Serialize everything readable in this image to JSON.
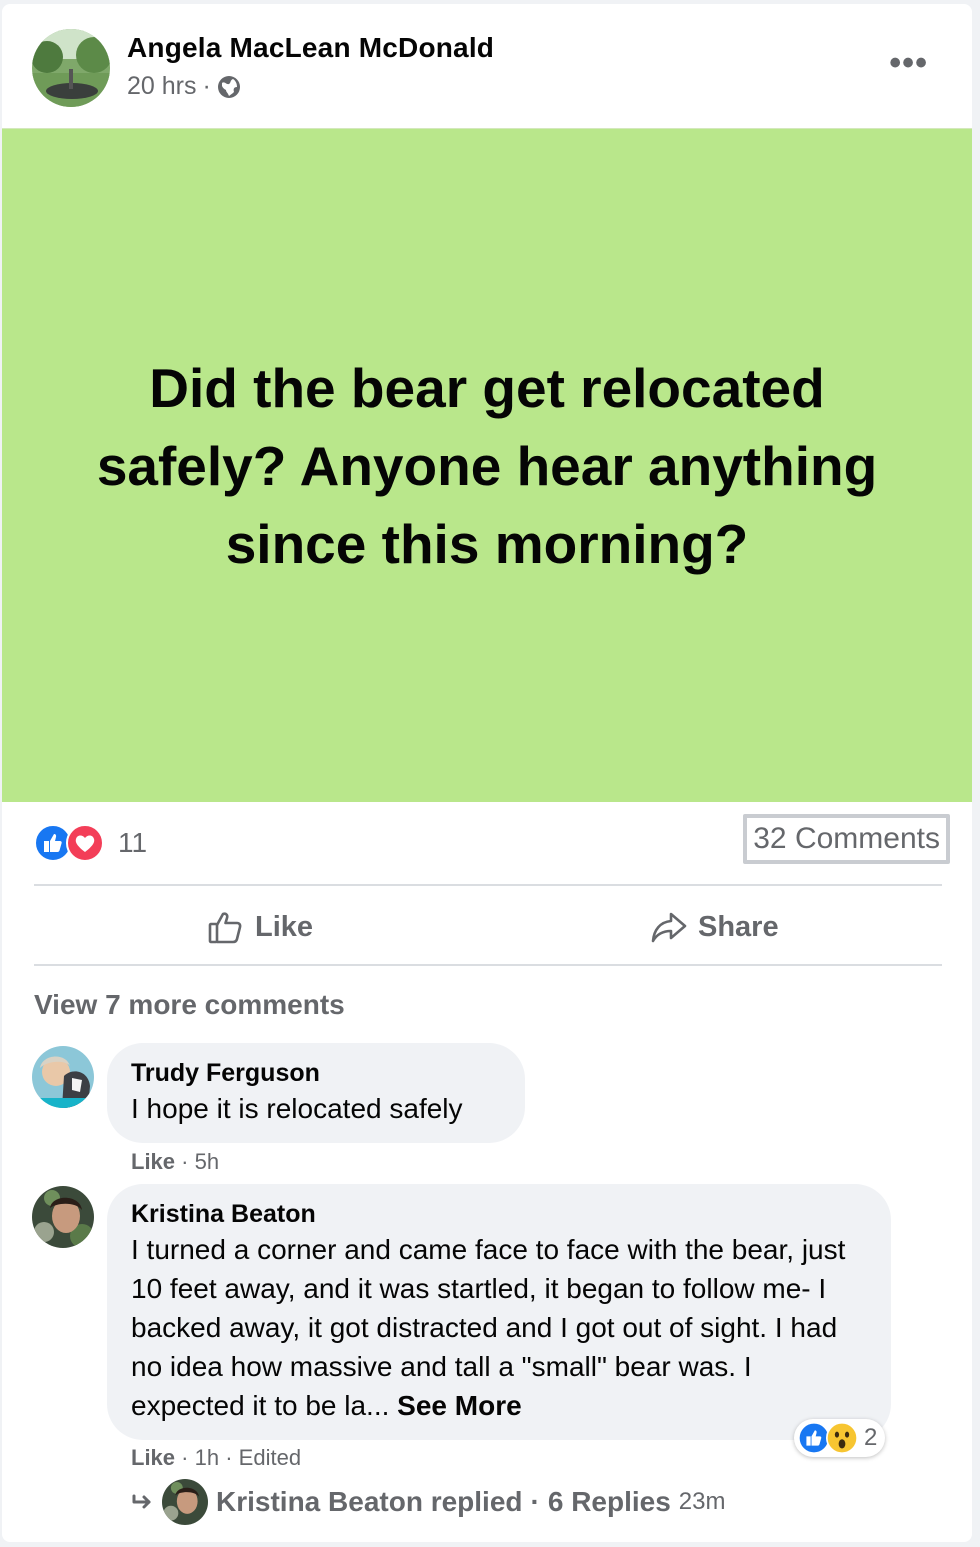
{
  "post": {
    "author": "Angela MacLean McDonald",
    "time": "20 hrs",
    "separator": "·",
    "privacy_icon": "globe-icon",
    "menu_icon": "more-options-icon",
    "status_text": "Did the bear get relocated safely? Anyone hear anything since this morning?",
    "status_bg_color": "#b9e78b"
  },
  "stats": {
    "reaction_icons": [
      "like-reaction-icon",
      "love-reaction-icon"
    ],
    "reaction_count": "11",
    "comments_label": "32 Comments"
  },
  "actions": {
    "like_label": "Like",
    "share_label": "Share"
  },
  "comments_section": {
    "view_more_label": "View 7 more comments",
    "comments": [
      {
        "name": "Trudy Ferguson",
        "text": "I hope it is relocated safely",
        "like_label": "Like",
        "time": "5h"
      },
      {
        "name": "Kristina Beaton",
        "text": "I turned a corner and came face to face with the bear, just 10 feet away, and it was startled, it began to follow me- I backed away, it got distracted and I got out of sight. I had no idea how massive and tall a \"small\" bear was. I expected it to be la...",
        "see_more_label": "See More",
        "like_label": "Like",
        "time": "1h",
        "edited_label": "Edited",
        "reaction_count": "2",
        "reaction_icons": [
          "like-reaction-icon",
          "wow-reaction-icon"
        ]
      }
    ],
    "replies": {
      "replier": "Kristina Beaton replied",
      "count_label": "6 Replies",
      "time": "23m"
    }
  }
}
